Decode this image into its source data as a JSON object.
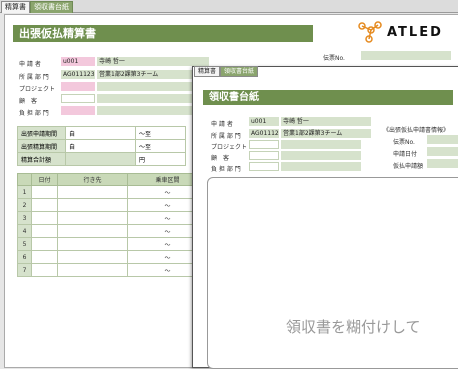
{
  "tabs": [
    {
      "label": "精算書",
      "active": false
    },
    {
      "label": "領収書台紙",
      "active": true
    }
  ],
  "main": {
    "title": "出張仮払精算書",
    "logo_text": "ATLED",
    "request_no_label": "伝票No.",
    "fields": {
      "applicant_label": "申 請 者",
      "applicant_id": "u001",
      "applicant_name": "寺崎 哲一",
      "dept_label": "所 属 部 門",
      "dept_code": "AG011123",
      "dept_name": "営業1部2課第3チーム",
      "project_label": "プロジェクト",
      "customer_label": "顧　客",
      "burden_label": "負 担 部 門"
    },
    "period": {
      "apply_label": "出張申請期間",
      "apply_from": "自",
      "apply_to": "～至",
      "settle_label": "出張精算期間",
      "settle_from": "自",
      "settle_to": "～至",
      "total_label": "精算合計額",
      "total_unit": "円"
    },
    "list": {
      "headers": [
        "",
        "日付",
        "行き先",
        "乗車区間"
      ],
      "rows": [
        {
          "n": "1",
          "sep": "～"
        },
        {
          "n": "2",
          "sep": "～"
        },
        {
          "n": "3",
          "sep": "～"
        },
        {
          "n": "4",
          "sep": "～"
        },
        {
          "n": "5",
          "sep": "～"
        },
        {
          "n": "6",
          "sep": "～"
        },
        {
          "n": "7",
          "sep": "～"
        }
      ]
    }
  },
  "popup": {
    "tabs": [
      {
        "label": "精算書",
        "active": false
      },
      {
        "label": "領収書台紙",
        "active": true
      }
    ],
    "title": "領収書台紙",
    "fields": {
      "applicant_label": "申 請 者",
      "applicant_id": "u001",
      "applicant_name": "寺崎 哲一",
      "dept_label": "所 属 部 門",
      "dept_code": "AG011123",
      "dept_name": "営業1部2課第3チーム",
      "project_label": "プロジェクト",
      "customer_label": "顧　客",
      "burden_label": "負 担 部 門"
    },
    "info": {
      "heading": "《出張仮払申請書情報》",
      "no_label": "伝票No.",
      "date_label": "申請日付",
      "temp_label": "仮払申請額"
    },
    "paste_text": "領収書を糊付けして"
  },
  "colors": {
    "accent": "#6f8f4e",
    "field": "#d6e2cc",
    "pink": "#f3c8dc"
  }
}
